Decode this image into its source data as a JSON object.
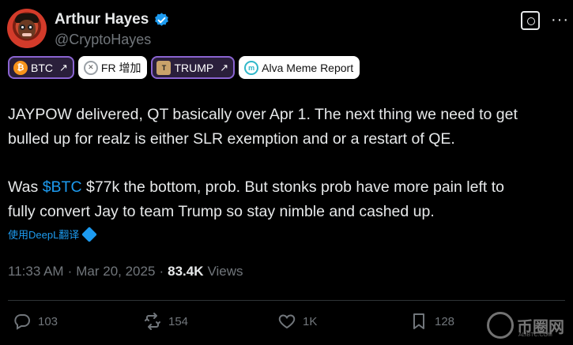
{
  "author": {
    "name": "Arthur Hayes",
    "handle": "@CryptoHayes"
  },
  "tags": [
    {
      "icon": "btc-coin-icon",
      "label": "BTC"
    },
    {
      "icon": "fr-icon",
      "label": "FR 增加"
    },
    {
      "icon": "trump-coin-icon",
      "label": "TRUMP"
    },
    {
      "icon": "alva-icon",
      "label": "Alva Meme Report"
    }
  ],
  "post": {
    "line1": "JAYPOW delivered, QT basically over Apr 1. The next thing we need to get",
    "line2": "bulled up for realz is either SLR exemption and or a restart of QE.",
    "line3_pre": "Was ",
    "cashtag": "$BTC",
    "line3_post": " $77k the bottom, prob. But stonks prob have more pain left to",
    "line4": "fully convert Jay to team Trump so stay nimble and cashed up."
  },
  "translate_label": "使用DeepL翻译",
  "meta": {
    "time": "11:33 AM",
    "sep1": "·",
    "date": "Mar 20, 2025",
    "sep2": "·",
    "views_count": "83.4K",
    "views_label": "Views"
  },
  "actions": {
    "replies": "103",
    "reposts": "154",
    "likes": "1K",
    "bookmarks": "128"
  },
  "watermark": {
    "text": "币圈网",
    "sub": "ALIBTC.COM"
  },
  "colors": {
    "accent": "#1d9bf0",
    "tag_border": "#8a64d1",
    "muted": "#71767b"
  }
}
